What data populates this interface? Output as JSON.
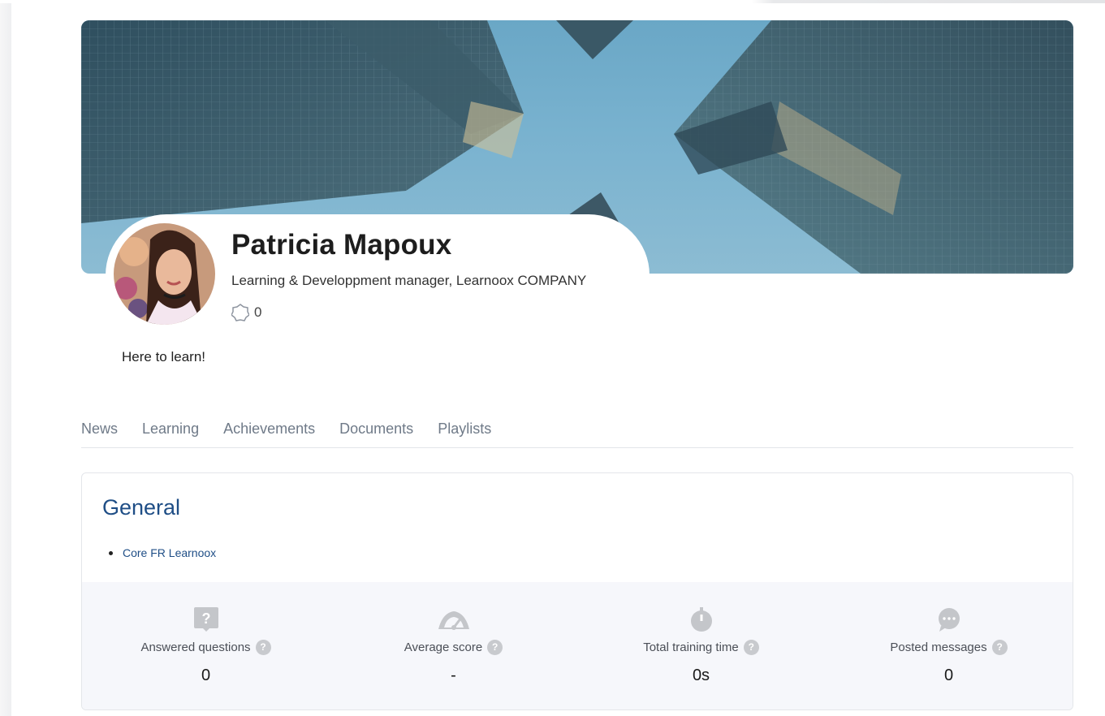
{
  "profile": {
    "name": "Patricia Mapoux",
    "job_title": "Learning & Developpment manager, Learnoox COMPANY",
    "points": "0",
    "bio": "Here to learn!"
  },
  "tabs": [
    {
      "label": "News"
    },
    {
      "label": "Learning"
    },
    {
      "label": "Achievements"
    },
    {
      "label": "Documents"
    },
    {
      "label": "Playlists"
    }
  ],
  "general": {
    "title": "General",
    "groups": [
      "Core FR Learnoox"
    ]
  },
  "stats": [
    {
      "label": "Answered questions",
      "value": "0",
      "icon": "question-icon"
    },
    {
      "label": "Average score",
      "value": "-",
      "icon": "speedometer-icon"
    },
    {
      "label": "Total training time",
      "value": "0s",
      "icon": "stopwatch-icon"
    },
    {
      "label": "Posted messages",
      "value": "0",
      "icon": "chat-bubble-icon"
    }
  ],
  "help_glyph": "?",
  "colors": {
    "accent": "#1f4e86",
    "tab_text": "#6f7a88",
    "stats_bg": "#f6f7fb",
    "icon_grey": "#c4c6ca"
  }
}
